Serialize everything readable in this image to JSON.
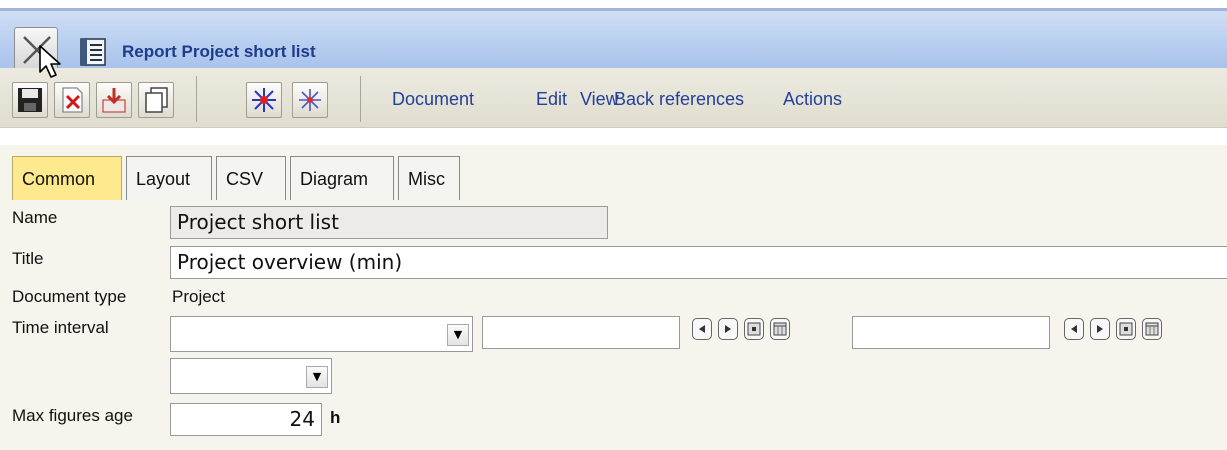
{
  "window": {
    "title": "Report Project short list"
  },
  "toolbar": {
    "buttons": [
      "save-icon",
      "delete-icon",
      "import-icon",
      "copy-icon",
      "expand-all-icon",
      "collapse-all-icon"
    ],
    "menu": [
      "Document",
      "Edit",
      "View",
      "Back references",
      "Actions"
    ]
  },
  "tabs": [
    "Common",
    "Layout",
    "CSV",
    "Diagram",
    "Misc"
  ],
  "active_tab": "Common",
  "form": {
    "name_label": "Name",
    "name_value": "Project short list",
    "title_label": "Title",
    "title_value": "Project overview (min)",
    "doctype_label": "Document type",
    "doctype_value": "Project",
    "interval_label": "Time interval",
    "interval_from": "",
    "interval_to": "",
    "interval_combo": "",
    "second_combo": "",
    "maxage_label": "Max figures age",
    "maxage_value": "24",
    "maxage_unit": "h"
  },
  "colors": {
    "titlebar": "#b9cff0",
    "title_text": "#1d3c8a",
    "menu_text": "#24409a",
    "active_tab": "#ffe98e",
    "content_bg": "#f5f5ee"
  }
}
